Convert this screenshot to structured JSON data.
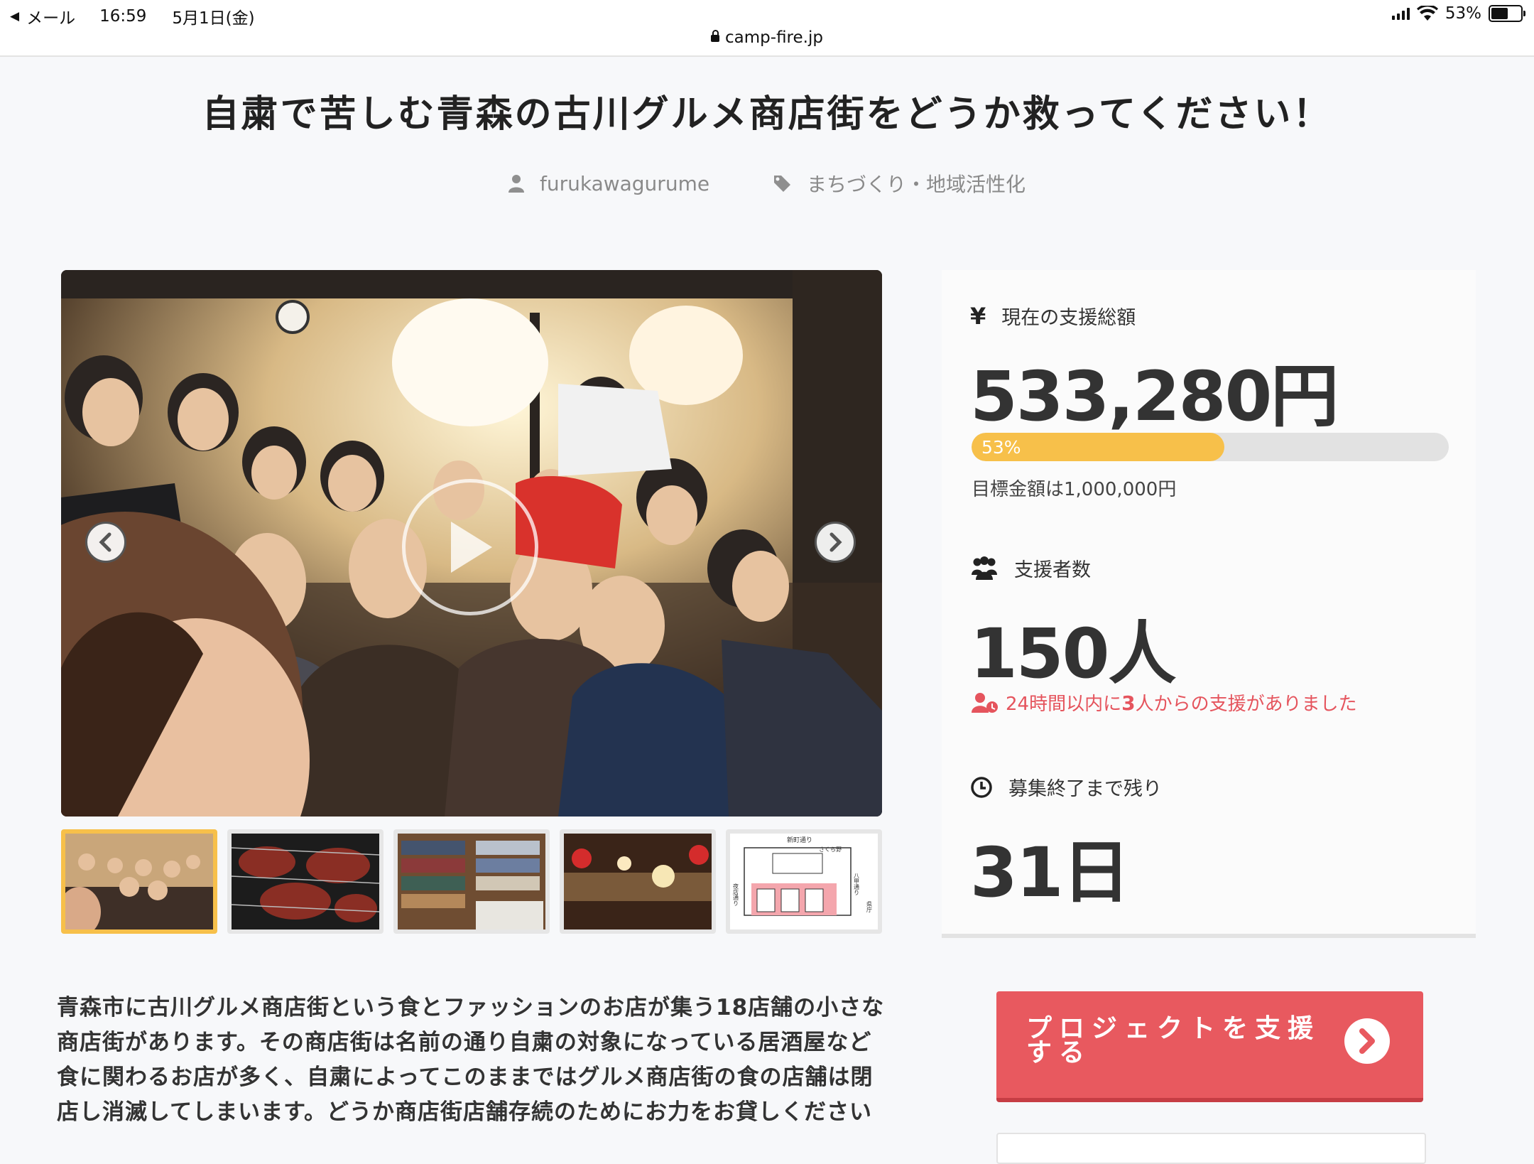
{
  "status_bar": {
    "back_app": "メール",
    "time": "16:59",
    "date": "5月1日(金)",
    "url": "camp-fire.jp",
    "battery": "53%"
  },
  "project": {
    "title": "自粛で苦しむ青森の古川グルメ商店街をどうか救ってください！",
    "owner": "furukawagurume",
    "category": "まちづくり・地域活性化",
    "description": "青森市に古川グルメ商店街という食とファッションのお店が集う18店舗の小さな\n商店街があります。その商店街は名前の通り自粛の対象になっている居酒屋など\n食に関わるお店が多く、自粛によってこのままではグルメ商店街の食の店舗は閉\n店し消滅してしまいます。どうか商店街店舗存続のためにお力をお貸しください"
  },
  "media": {
    "thumbnails": [
      "group-photo",
      "grilled-meat",
      "fashion-shelves",
      "restaurant-interior",
      "shopping-street-map"
    ],
    "map_labels": {
      "top_street": "新町通り",
      "left_street": "夜店通り",
      "right_street": "八甲通り",
      "shop": "さくら野",
      "office": "県庁"
    }
  },
  "stats": {
    "amount_label": "現在の支援総額",
    "amount": "533,280円",
    "progress_percent": 53,
    "progress_label": "53%",
    "goal": "目標金額は1,000,000円",
    "backers_label": "支援者数",
    "backers": "150人",
    "recent_prefix": "24時間以内に",
    "recent_count": "3",
    "recent_suffix": "人からの支援がありました",
    "remaining_label": "募集終了まで残り",
    "remaining": "31日"
  },
  "cta": {
    "support_label": "プロジェクトを支援する"
  },
  "colors": {
    "accent_yellow": "#f7c04a",
    "cta_red": "#e8595f",
    "alert_red": "#e5545d"
  }
}
